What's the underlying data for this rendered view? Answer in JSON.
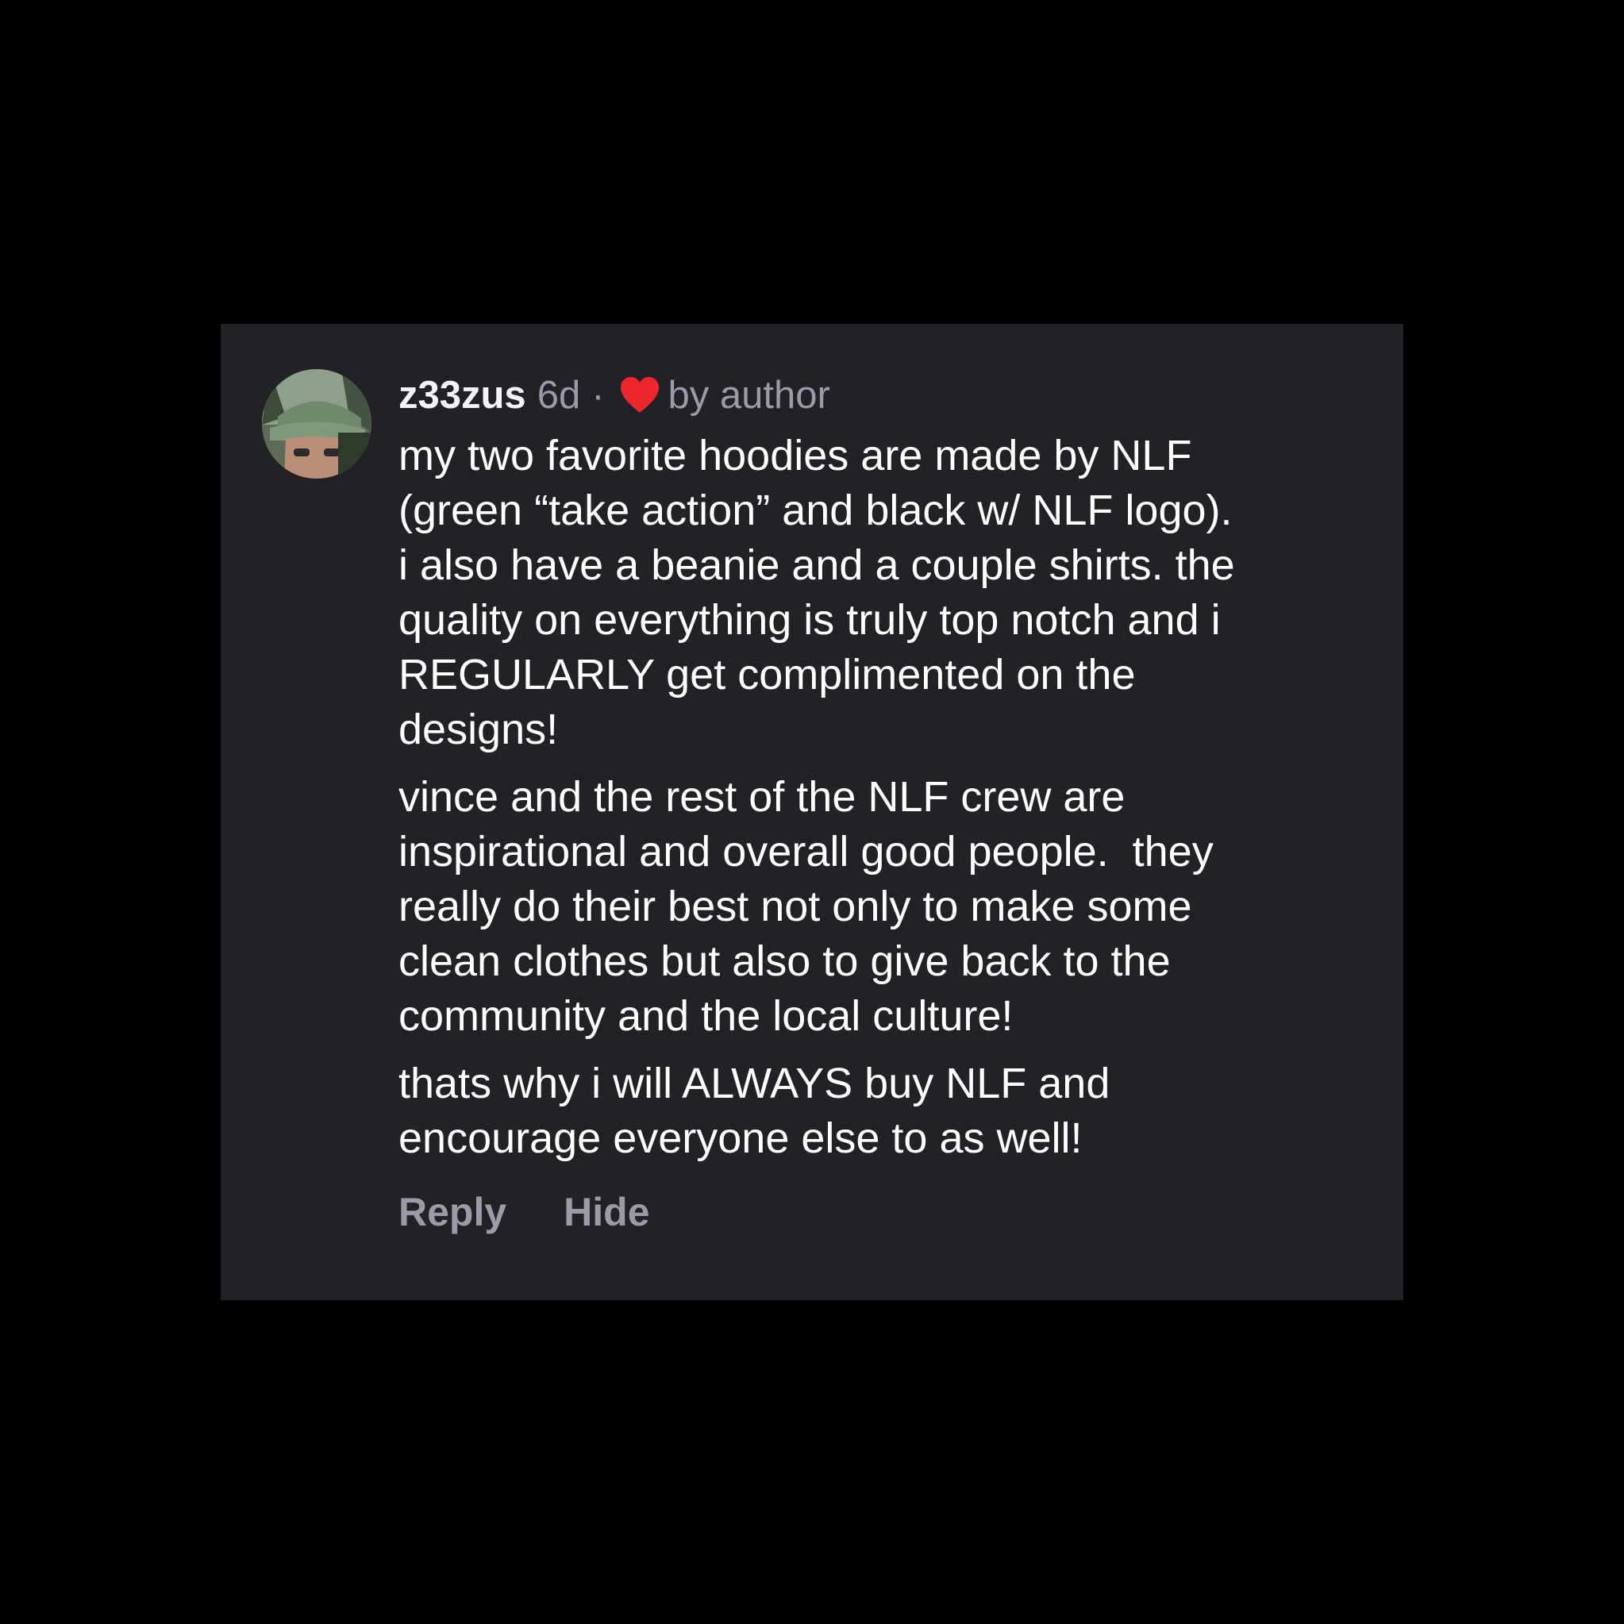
{
  "comment": {
    "username": "z33zus",
    "age": "6d",
    "separator": "·",
    "liked_by_author_label": "by author",
    "paragraphs": [
      "my two favorite hoodies are made by NLF\n(green “take action” and black w/ NLF logo).\ni also have a beanie and a couple shirts. the\nquality on everything is truly top notch and i\nREGULARLY get complimented on the\ndesigns!",
      "vince and the rest of the NLF crew are\ninspirational and overall good people.  they\nreally do their best not only to make some\nclean clothes but also to give back to the\ncommunity and the local culture!",
      "thats why i will ALWAYS buy NLF and\nencourage everyone else to as well!"
    ],
    "actions": {
      "reply_label": "Reply",
      "hide_label": "Hide"
    }
  },
  "colors": {
    "background": "#000000",
    "card": "#212126",
    "text": "#ffffff",
    "muted": "#9a9ba6",
    "heart": "#f0262f"
  },
  "icons": {
    "heart": "heart-icon",
    "avatar": "avatar"
  }
}
